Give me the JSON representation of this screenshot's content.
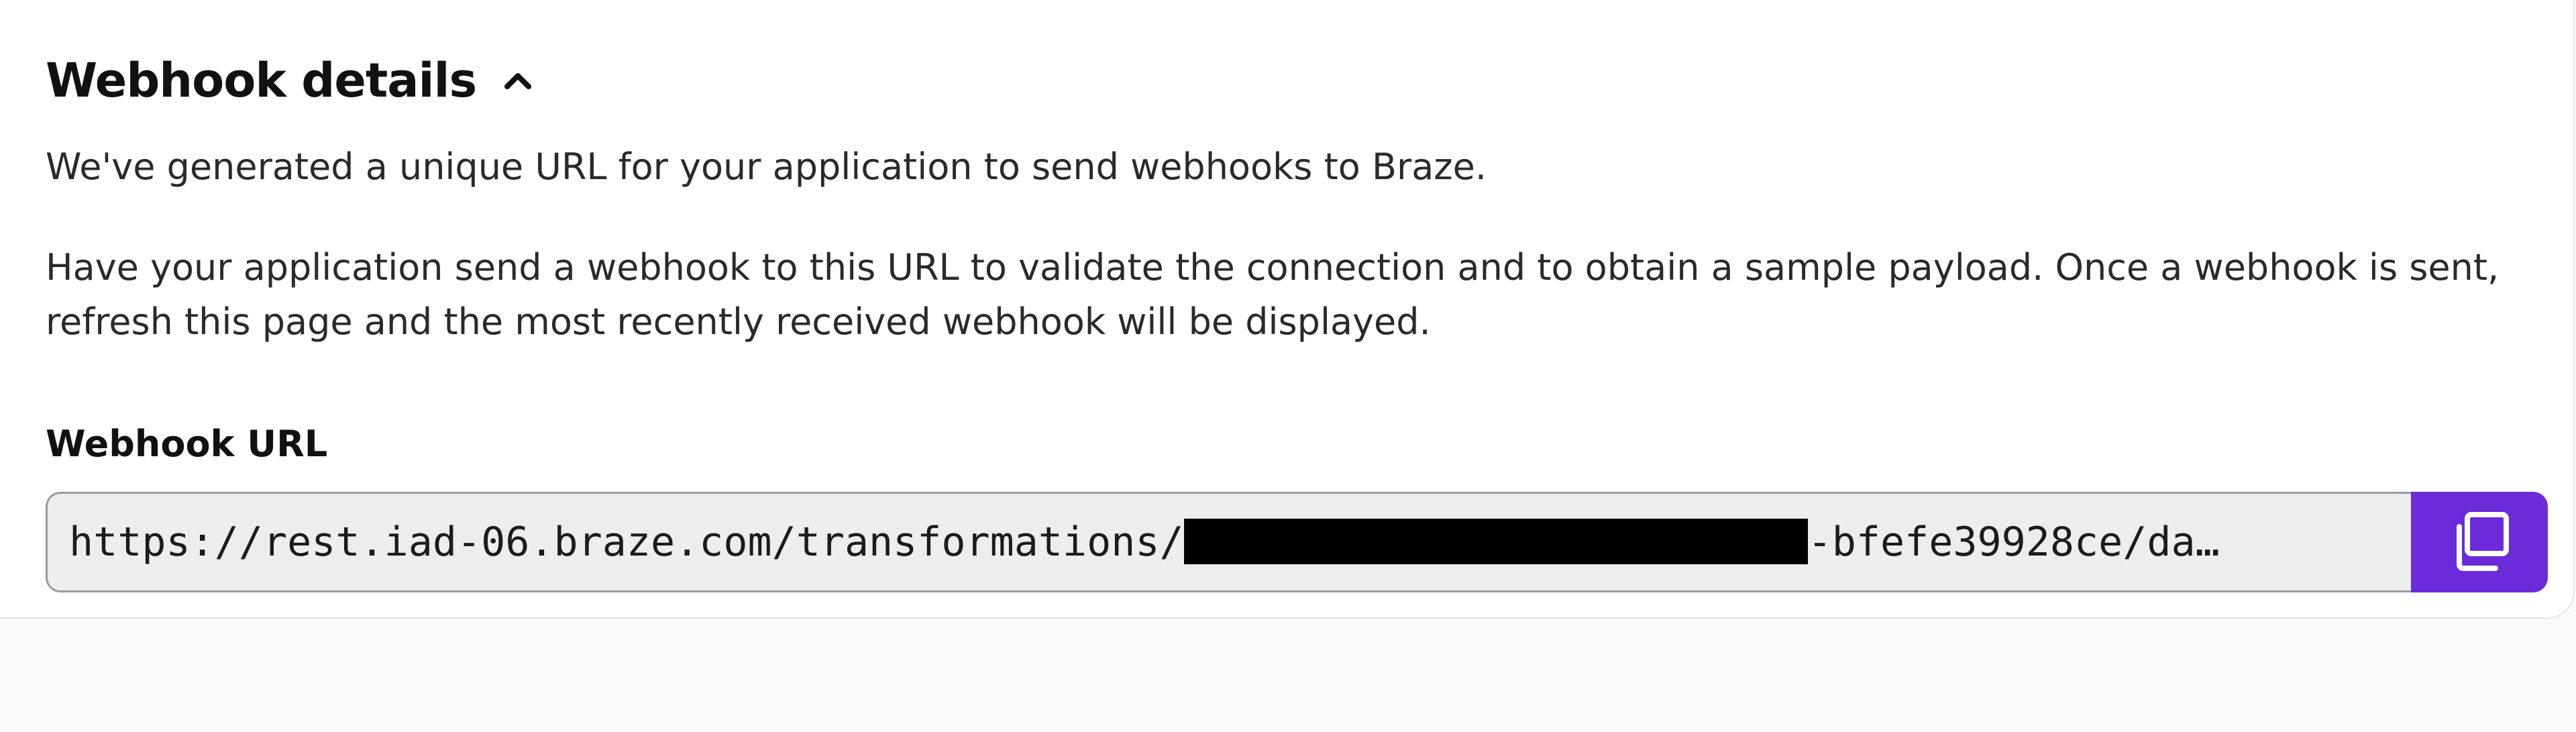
{
  "section": {
    "title": "Webhook details",
    "chevron_icon": "chevron-up-icon"
  },
  "description": {
    "paragraph_1": "We've generated a unique URL for your application to send webhooks to Braze.",
    "paragraph_2": "Have your application send a webhook to this URL to validate the connection and to obtain a sample payload. Once a webhook is sent, refresh this page and the most recently received webhook will be displayed."
  },
  "webhook_url": {
    "label": "Webhook URL",
    "value_prefix": "https://rest.iad-06.braze.com/transformations/",
    "value_suffix": "-bfefe39928ce/da…",
    "copy_icon": "copy-icon"
  },
  "colors": {
    "accent": "#6b2bd9",
    "input_bg": "#ededed",
    "text": "#1b1b1b"
  }
}
